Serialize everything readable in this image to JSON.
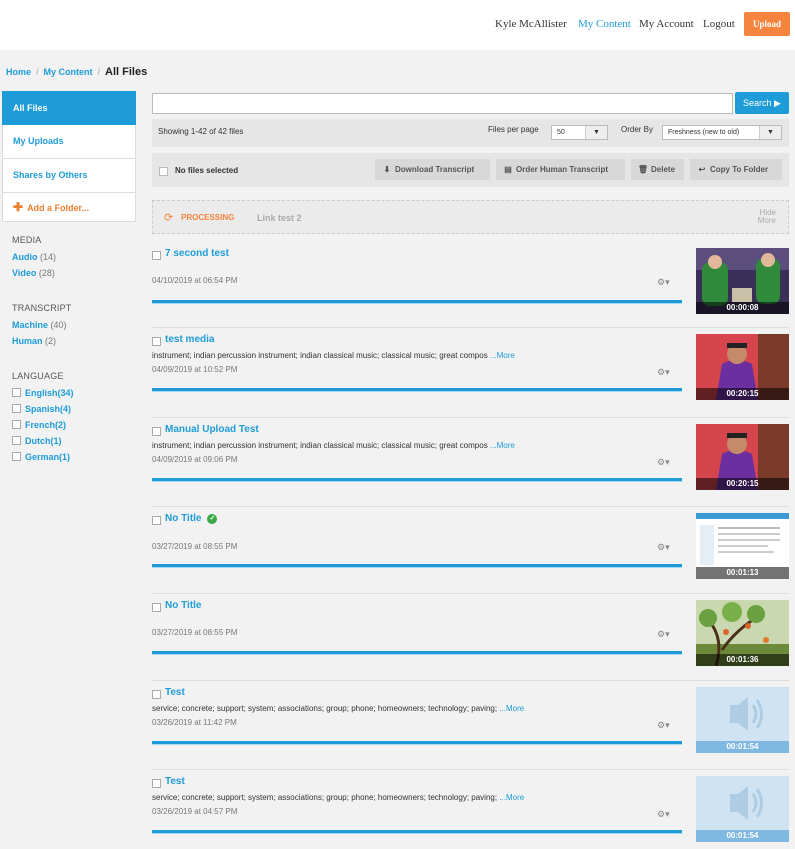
{
  "header": {
    "user_name": "Kyle McAllister",
    "my_content": "My Content",
    "my_account": "My Account",
    "logout": "Logout",
    "upload": "Upload",
    "accent_color": "#1e9cd7",
    "upload_color": "#f5843f"
  },
  "breadcrumb": {
    "home": "Home",
    "my_content": "My Content",
    "current": "All Files",
    "separator": "/"
  },
  "sidebar": {
    "items": [
      {
        "label": "All Files",
        "active": true
      },
      {
        "label": "My Uploads"
      },
      {
        "label": "Shares by Others"
      }
    ],
    "add_folder": "Add a Folder...",
    "media": {
      "heading": "MEDIA",
      "items": [
        {
          "label": "Audio",
          "count": "(14)"
        },
        {
          "label": "Video",
          "count": "(28)"
        }
      ]
    },
    "transcript": {
      "heading": "TRANSCRIPT",
      "items": [
        {
          "label": "Machine",
          "count": "(40)"
        },
        {
          "label": "Human",
          "count": "(2)"
        }
      ]
    },
    "language": {
      "heading": "LANGUAGE",
      "items": [
        "English(34)",
        "Spanish(4)",
        "French(2)",
        "Dutch(1)",
        "German(1)"
      ]
    }
  },
  "search": {
    "button": "Search ▶",
    "placeholder": ""
  },
  "listing": {
    "showing": "Showing 1-42 of 42 files",
    "per_page_label": "Files per page",
    "per_page_value": "50",
    "order_label": "Order By",
    "order_value": "Freshness (new to old)"
  },
  "actions": {
    "no_selection": "No files selected",
    "download": "Download Transcript",
    "order_human": "Order Human Transcript",
    "delete": "Delete",
    "copy": "Copy To Folder"
  },
  "processing": {
    "status": "PROCESSING",
    "name": "Link test 2",
    "hide": "Hide",
    "more": "More"
  },
  "files": [
    {
      "title": "7 second test",
      "keywords": "",
      "more": "",
      "date": "04/10/2019 at 06:54 PM",
      "duration": "00:00:08",
      "thumb": "video-green",
      "verified": false
    },
    {
      "title": "test media",
      "keywords": "instrument; indian percussion instrument; indian classical music; classical music; great compos",
      "more": "...More",
      "date": "04/09/2019 at 10:52 PM",
      "duration": "00:20:15",
      "thumb": "video-purple",
      "verified": false
    },
    {
      "title": "Manual Upload Test",
      "keywords": "instrument; indian percussion instrument; indian classical music; classical music; great compos",
      "more": "...More",
      "date": "04/09/2019 at 09:06 PM",
      "duration": "00:20:15",
      "thumb": "video-purple",
      "verified": false
    },
    {
      "title": "No Title",
      "keywords": "",
      "more": "",
      "date": "03/27/2019 at 08:55 PM",
      "duration": "00:01:13",
      "thumb": "screen",
      "verified": true
    },
    {
      "title": "No Title",
      "keywords": "",
      "more": "",
      "date": "03/27/2019 at 08:55 PM",
      "duration": "00:01:36",
      "thumb": "tree",
      "verified": false
    },
    {
      "title": "Test",
      "keywords": "service; concrete; support; system; associations; group; phone; homeowners; technology; paving;",
      "more": "...More",
      "date": "03/26/2019 at 11:42 PM",
      "duration": "00:01:54",
      "thumb": "audio",
      "verified": false
    },
    {
      "title": "Test",
      "keywords": "service; concrete; support; system; associations; group; phone; homeowners; technology; paving;",
      "more": "...More",
      "date": "03/26/2019 at 04:57 PM",
      "duration": "00:01:54",
      "thumb": "audio",
      "verified": false
    }
  ]
}
